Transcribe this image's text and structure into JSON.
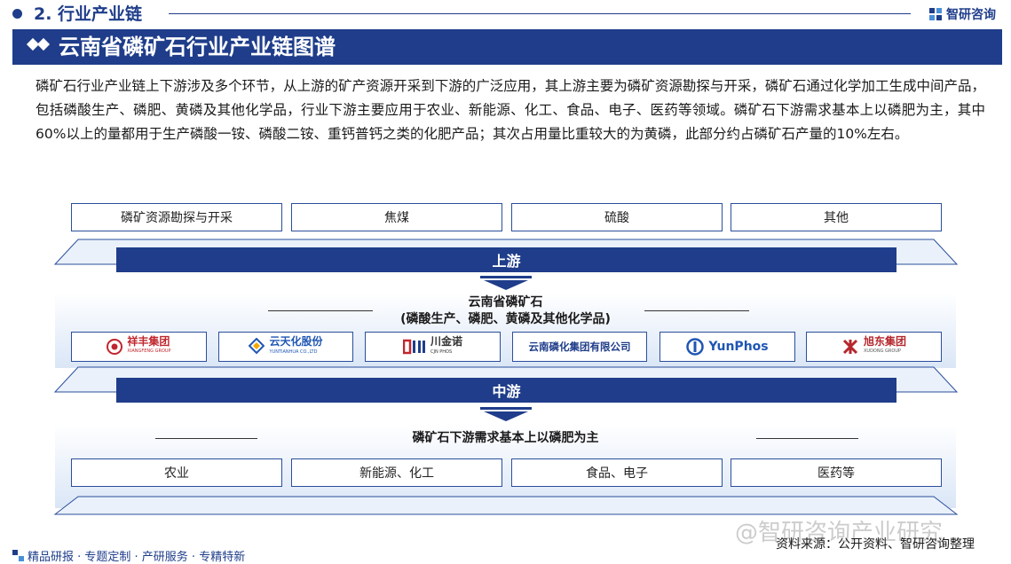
{
  "header": {
    "section_title": "2. 行业产业链",
    "logo_text": "智研咨询",
    "banner_title": "云南省磷矿石行业产业链图谱"
  },
  "intro": "磷矿石行业产业链上下游涉及多个环节，从上游的矿产资源开采到下游的广泛应用，其上游主要为磷矿资源勘探与开采，磷矿石通过化学加工生成中间产品，包括磷酸生产、磷肥、黄磷及其他化学品，行业下游主要应用于农业、新能源、化工、食品、电子、医药等领域。磷矿石下游需求基本上以磷肥为主，其中60%以上的量都用于生产磷酸一铵、磷酸二铵、重钙普钙之类的化肥产品；其次占用量比重较大的为黄磷，此部分约占磷矿石产量的10%左右。",
  "upstream": {
    "label": "上游",
    "items": [
      "磷矿资源勘探与开采",
      "焦煤",
      "硫酸",
      "其他"
    ]
  },
  "midstream": {
    "label": "中游",
    "title_line1": "云南省磷矿石",
    "title_line2": "(磷酸生产、磷肥、黄磷及其他化学品)",
    "companies": [
      {
        "name": "祥丰集团",
        "sub": "XIANGFENG GROUP",
        "color": "#c0262d"
      },
      {
        "name": "云天化股份",
        "sub": "YUNTIANHUA CO.,LTD",
        "color": "#1f56b3"
      },
      {
        "name": "川金诺",
        "sub": "CJN PHOS",
        "color": "#333333"
      },
      {
        "name": "云南磷化集团有限公司",
        "sub": "",
        "color": "#1f3d8a"
      },
      {
        "name": "YunPhos",
        "sub": "",
        "color": "#1f56b3"
      },
      {
        "name": "旭东集团",
        "sub": "XUDONG GROUP",
        "color": "#b5262c"
      }
    ]
  },
  "downstream": {
    "title": "磷矿石下游需求基本上以磷肥为主",
    "items": [
      "农业",
      "新能源、化工",
      "食品、电子",
      "医药等"
    ]
  },
  "footer": {
    "left": "精品研报 · 专题定制 · 产研服务 · 专精特新",
    "source": "资料来源：公开资料、智研咨询整理",
    "watermark": "@智研咨询产业研究"
  },
  "colors": {
    "primary": "#1f3d8a",
    "box_border": "#2a4f9b"
  }
}
